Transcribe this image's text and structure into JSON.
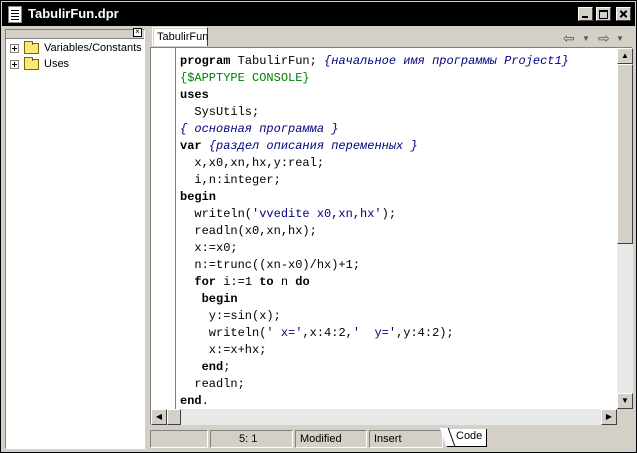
{
  "window": {
    "title": "TabulirFun.dpr"
  },
  "explorer": {
    "items": [
      {
        "label": "Variables/Constants",
        "icon": "folder-icon"
      },
      {
        "label": "Uses",
        "icon": "folder-icon"
      }
    ]
  },
  "editor": {
    "tab": "TabulirFun",
    "code_lines": [
      [
        {
          "t": "program",
          "k": "kw"
        },
        {
          "t": " TabulirFun; ",
          "k": ""
        },
        {
          "t": "{начальное имя программы Project1}",
          "k": "cm"
        }
      ],
      [
        {
          "t": "{$APPTYPE CONSOLE}",
          "k": "dir"
        }
      ],
      [
        {
          "t": "uses",
          "k": "kw"
        }
      ],
      [
        {
          "t": "  SysUtils;",
          "k": ""
        }
      ],
      [
        {
          "t": "{ основная программа }",
          "k": "cm"
        }
      ],
      [
        {
          "t": "var",
          "k": "kw"
        },
        {
          "t": " ",
          "k": ""
        },
        {
          "t": "{раздел описания переменных }",
          "k": "cm"
        }
      ],
      [
        {
          "t": "  x,x0,xn,hx,y:real;",
          "k": ""
        }
      ],
      [
        {
          "t": "  i,n:integer;",
          "k": ""
        }
      ],
      [
        {
          "t": "begin",
          "k": "kw"
        }
      ],
      [
        {
          "t": "  writeln(",
          "k": ""
        },
        {
          "t": "'vvedite x0,xn,hx'",
          "k": "str"
        },
        {
          "t": ");",
          "k": ""
        }
      ],
      [
        {
          "t": "  readln(x0,xn,hx);",
          "k": ""
        }
      ],
      [
        {
          "t": "  x:=x0;",
          "k": ""
        }
      ],
      [
        {
          "t": "  n:=trunc((xn-x0)/hx)+1;",
          "k": ""
        }
      ],
      [
        {
          "t": "  ",
          "k": ""
        },
        {
          "t": "for",
          "k": "kw"
        },
        {
          "t": " i:=1 ",
          "k": ""
        },
        {
          "t": "to",
          "k": "kw"
        },
        {
          "t": " n ",
          "k": ""
        },
        {
          "t": "do",
          "k": "kw"
        }
      ],
      [
        {
          "t": "   ",
          "k": ""
        },
        {
          "t": "begin",
          "k": "kw"
        }
      ],
      [
        {
          "t": "    y:=sin(x);",
          "k": ""
        }
      ],
      [
        {
          "t": "    writeln(",
          "k": ""
        },
        {
          "t": "' x='",
          "k": "str"
        },
        {
          "t": ",x:4:2,",
          "k": ""
        },
        {
          "t": "'  y='",
          "k": "str"
        },
        {
          "t": ",y:4:2);",
          "k": ""
        }
      ],
      [
        {
          "t": "    x:=x+hx;",
          "k": ""
        }
      ],
      [
        {
          "t": "   ",
          "k": ""
        },
        {
          "t": "end",
          "k": "kw"
        },
        {
          "t": ";",
          "k": ""
        }
      ],
      [
        {
          "t": "  readln;",
          "k": ""
        }
      ],
      [
        {
          "t": "end",
          "k": "kw"
        },
        {
          "t": ".",
          "k": ""
        }
      ]
    ]
  },
  "statusbar": {
    "position": "5:  1",
    "modified": "Modified",
    "mode": "Insert",
    "view_tab": "Code"
  }
}
